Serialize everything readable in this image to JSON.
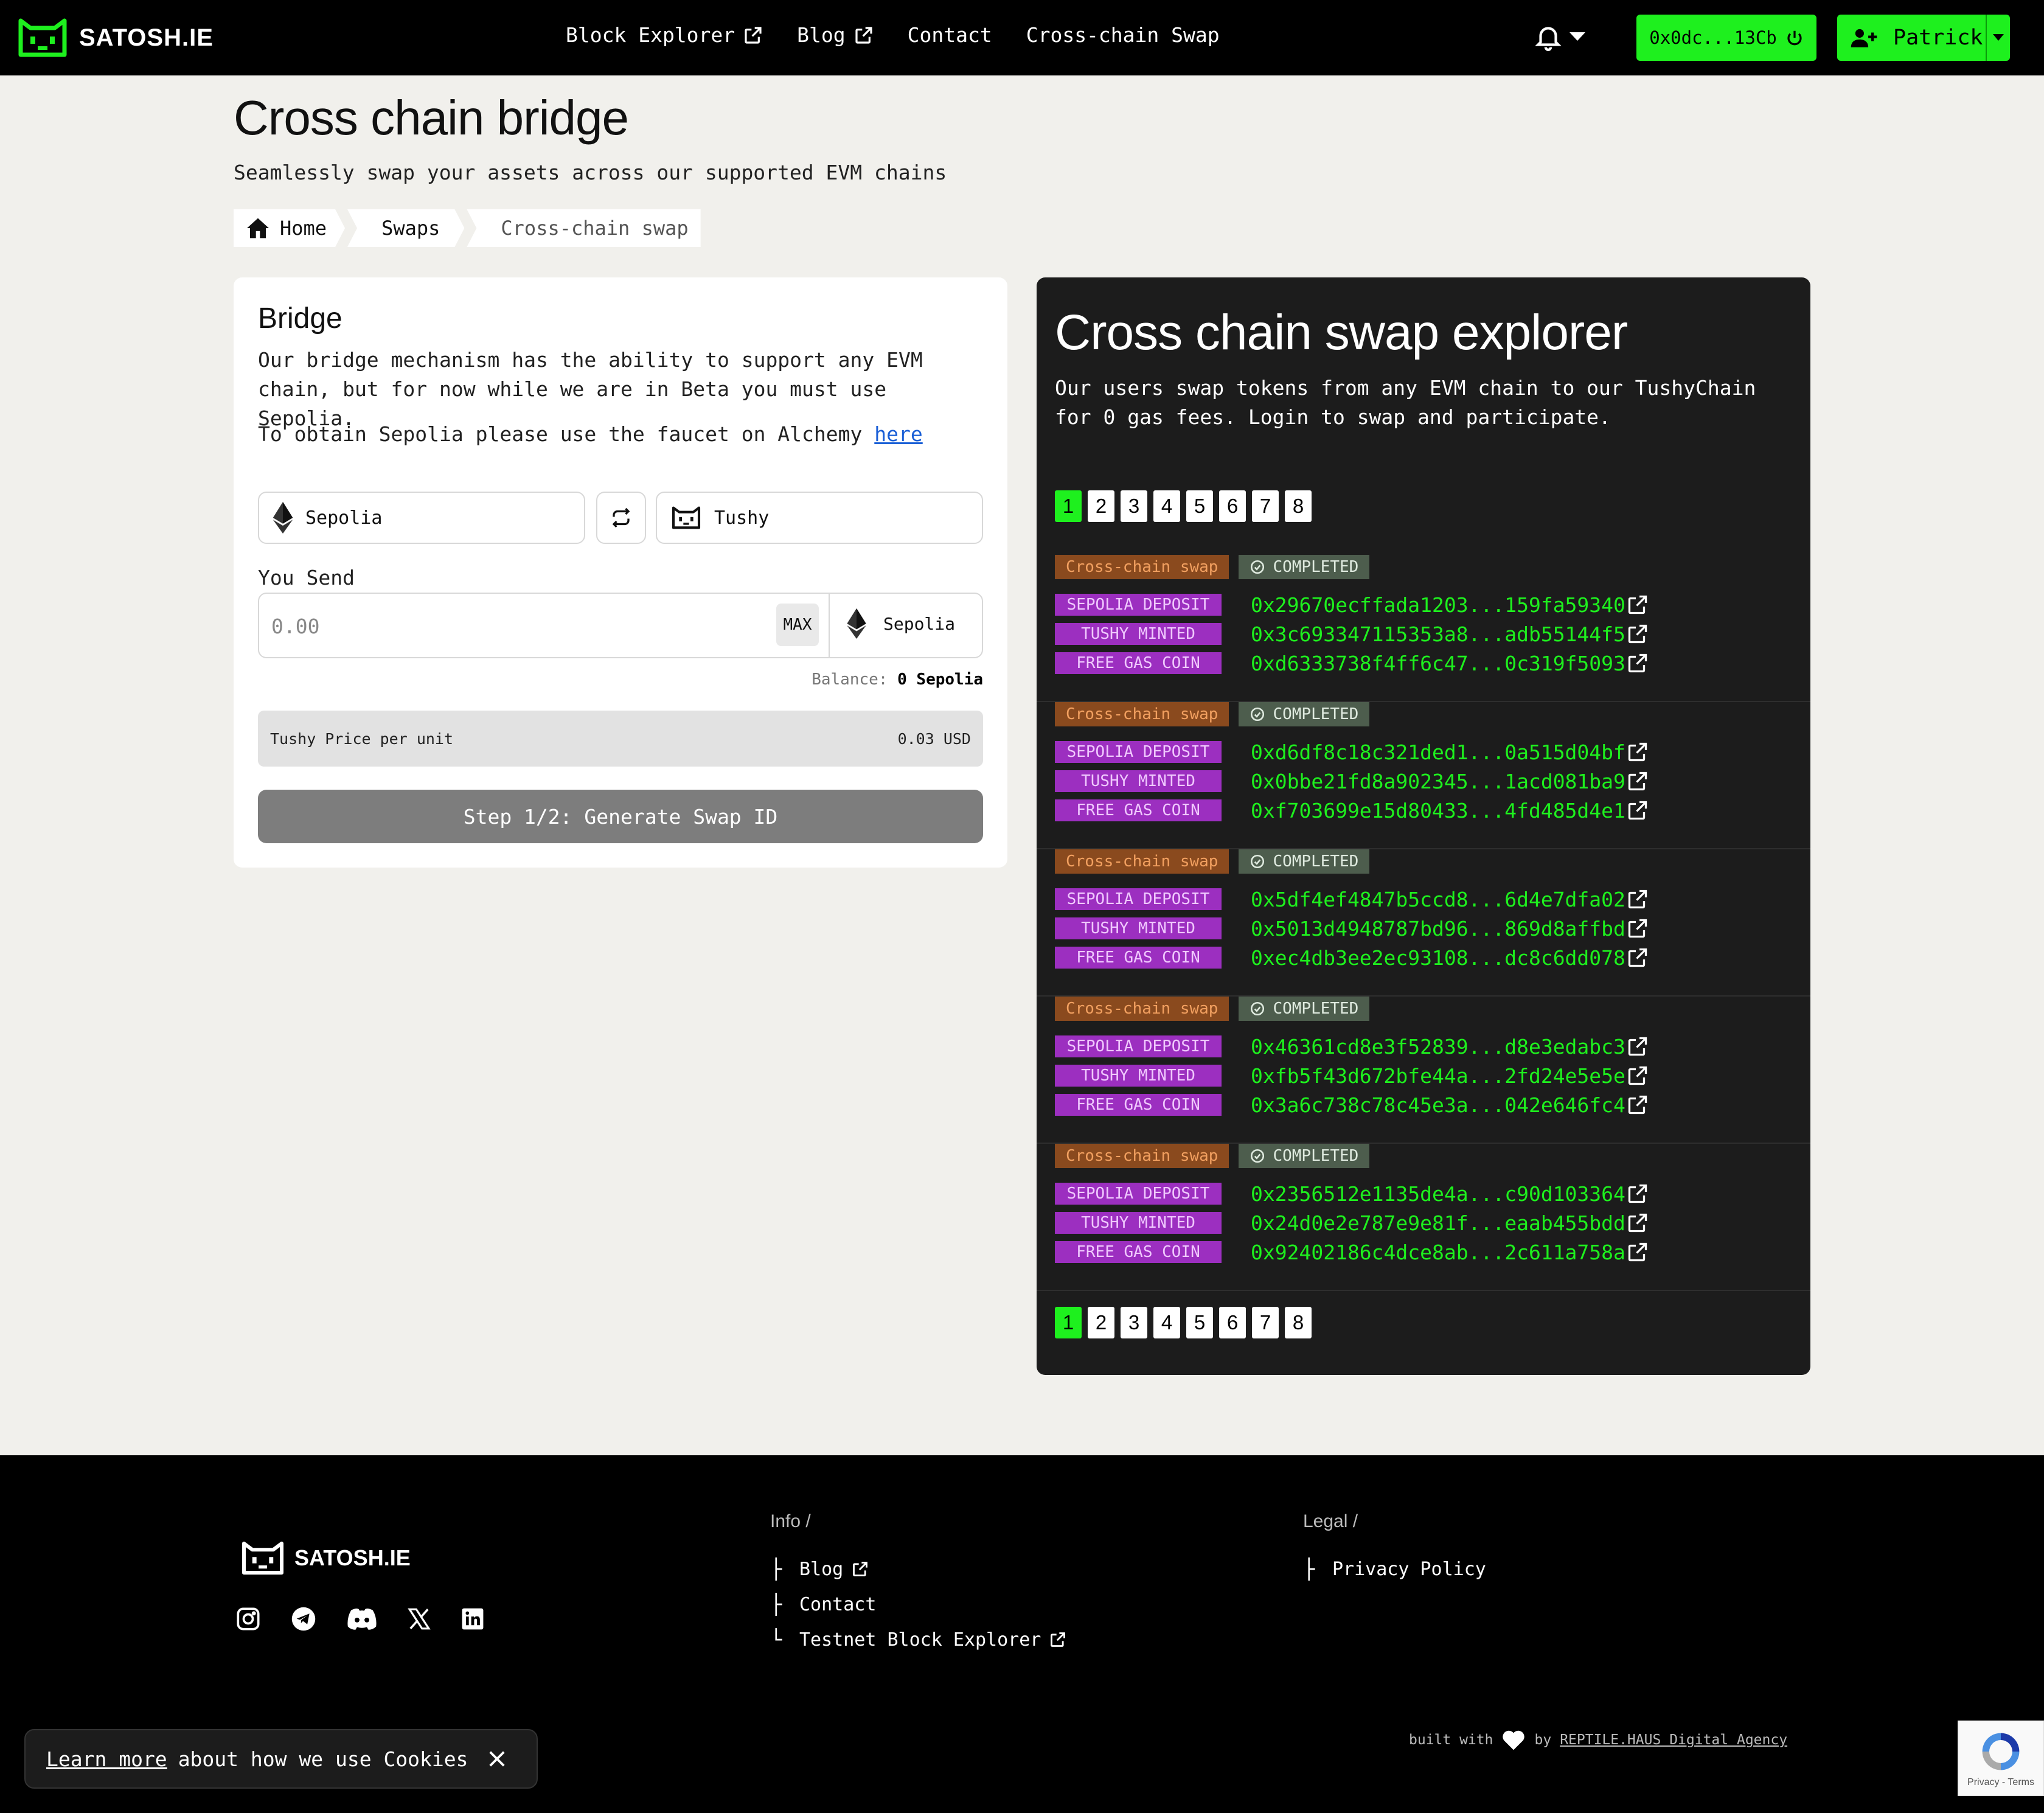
{
  "header": {
    "logo_text": "SATOSH.IE",
    "nav": [
      {
        "label": "Block Explorer",
        "external": true
      },
      {
        "label": "Blog",
        "external": true
      },
      {
        "label": "Contact",
        "external": false
      },
      {
        "label": "Cross-chain Swap",
        "external": false
      }
    ],
    "wallet_label": "0x0dc...13Cb",
    "user_name": "Patrick"
  },
  "page": {
    "title": "Cross chain bridge",
    "subtitle": "Seamlessly swap your assets across our supported EVM chains",
    "breadcrumb": {
      "home": "Home",
      "swaps": "Swaps",
      "current": "Cross-chain swap"
    }
  },
  "bridge": {
    "title": "Bridge",
    "description": "Our bridge mechanism has the ability to support any EVM chain, but for now while we are in Beta you must use Sepolia.",
    "faucet_text": "To obtain Sepolia please use the faucet on Alchemy ",
    "faucet_link": "here",
    "from_chain": "Sepolia",
    "to_chain": "Tushy",
    "you_send_label": "You Send",
    "amount_placeholder": "0.00",
    "max_label": "MAX",
    "send_token": "Sepolia",
    "balance_label": "Balance:",
    "balance_value": "0 Sepolia",
    "price_label": "Tushy Price per unit",
    "price_value": "0.03 USD",
    "generate_button": "Step 1/2: Generate Swap ID"
  },
  "explorer": {
    "title": "Cross chain swap explorer",
    "description": "Our users swap tokens from any EVM chain to our TushyChain for 0 gas fees. Login to swap and participate.",
    "pages": [
      "1",
      "2",
      "3",
      "4",
      "5",
      "6",
      "7",
      "8"
    ],
    "active_page": "1",
    "swaps": [
      {
        "type": "Cross-chain swap",
        "status": "COMPLETED",
        "txs": [
          {
            "label": "SEPOLIA DEPOSIT",
            "hash": "0x29670ecffada1203...159fa59340"
          },
          {
            "label": "TUSHY MINTED",
            "hash": "0x3c693347115353a8...adb55144f5"
          },
          {
            "label": "FREE GAS COIN",
            "hash": "0xd6333738f4ff6c47...0c319f5093"
          }
        ]
      },
      {
        "type": "Cross-chain swap",
        "status": "COMPLETED",
        "txs": [
          {
            "label": "SEPOLIA DEPOSIT",
            "hash": "0xd6df8c18c321ded1...0a515d04bf"
          },
          {
            "label": "TUSHY MINTED",
            "hash": "0x0bbe21fd8a902345...1acd081ba9"
          },
          {
            "label": "FREE GAS COIN",
            "hash": "0xf703699e15d80433...4fd485d4e1"
          }
        ]
      },
      {
        "type": "Cross-chain swap",
        "status": "COMPLETED",
        "txs": [
          {
            "label": "SEPOLIA DEPOSIT",
            "hash": "0x5df4ef4847b5ccd8...6d4e7dfa02"
          },
          {
            "label": "TUSHY MINTED",
            "hash": "0x5013d4948787bd96...869d8affbd"
          },
          {
            "label": "FREE GAS COIN",
            "hash": "0xec4db3ee2ec93108...dc8c6dd078"
          }
        ]
      },
      {
        "type": "Cross-chain swap",
        "status": "COMPLETED",
        "txs": [
          {
            "label": "SEPOLIA DEPOSIT",
            "hash": "0x46361cd8e3f52839...d8e3edabc3"
          },
          {
            "label": "TUSHY MINTED",
            "hash": "0xfb5f43d672bfe44a...2fd24e5e5e"
          },
          {
            "label": "FREE GAS COIN",
            "hash": "0x3a6c738c78c45e3a...042e646fc4"
          }
        ]
      },
      {
        "type": "Cross-chain swap",
        "status": "COMPLETED",
        "txs": [
          {
            "label": "SEPOLIA DEPOSIT",
            "hash": "0x2356512e1135de4a...c90d103364"
          },
          {
            "label": "TUSHY MINTED",
            "hash": "0x24d0e2e787e9e81f...eaab455bdd"
          },
          {
            "label": "FREE GAS COIN",
            "hash": "0x92402186c4dce8ab...2c611a758a"
          }
        ]
      }
    ]
  },
  "footer": {
    "logo_text": "SATOSH.IE",
    "socials": [
      "instagram-icon",
      "telegram-icon",
      "discord-icon",
      "x-icon",
      "linkedin-icon"
    ],
    "info_heading": "Info /",
    "info_links": [
      "Blog",
      "Contact",
      "Testnet Block Explorer"
    ],
    "legal_heading": "Legal /",
    "legal_links": [
      "Privacy Policy"
    ],
    "built_with": "built with",
    "by": "by",
    "agency": "REPTILE.HAUS Digital Agency"
  },
  "cookie": {
    "learn_more": "Learn more",
    "text": "about how we use Cookies"
  },
  "recaptcha": {
    "links": "Privacy - Terms"
  },
  "colors": {
    "accent_green": "#1ef01e",
    "tx_purple": "#9c2fc0",
    "tag_orange": "#8a4a1e",
    "header_bg": "#000000",
    "explorer_bg": "#1c1c1c"
  }
}
